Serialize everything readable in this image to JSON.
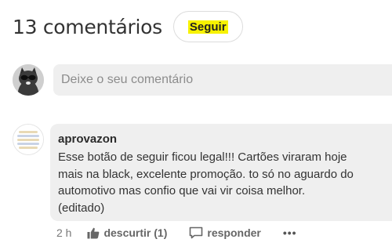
{
  "header": {
    "comment_count_title": "13 comentários",
    "follow_label": "Seguir"
  },
  "composer": {
    "placeholder": "Deixe o seu comentário"
  },
  "comment": {
    "author": "aprovazon",
    "lines": [
      "Esse botão de seguir ficou legal!!! Cartões viraram hoje",
      "mais na black, excelente promoção. to só no aguardo do",
      "automotivo mas confio que vai vir coisa melhor.",
      "(editado)"
    ],
    "time": "2 h",
    "dislike_label": "descurtir (1)",
    "reply_label": "responder",
    "more_label": "•••"
  },
  "colors": {
    "follow_highlight": "#f7f200",
    "bubble_bg": "#efefef"
  }
}
